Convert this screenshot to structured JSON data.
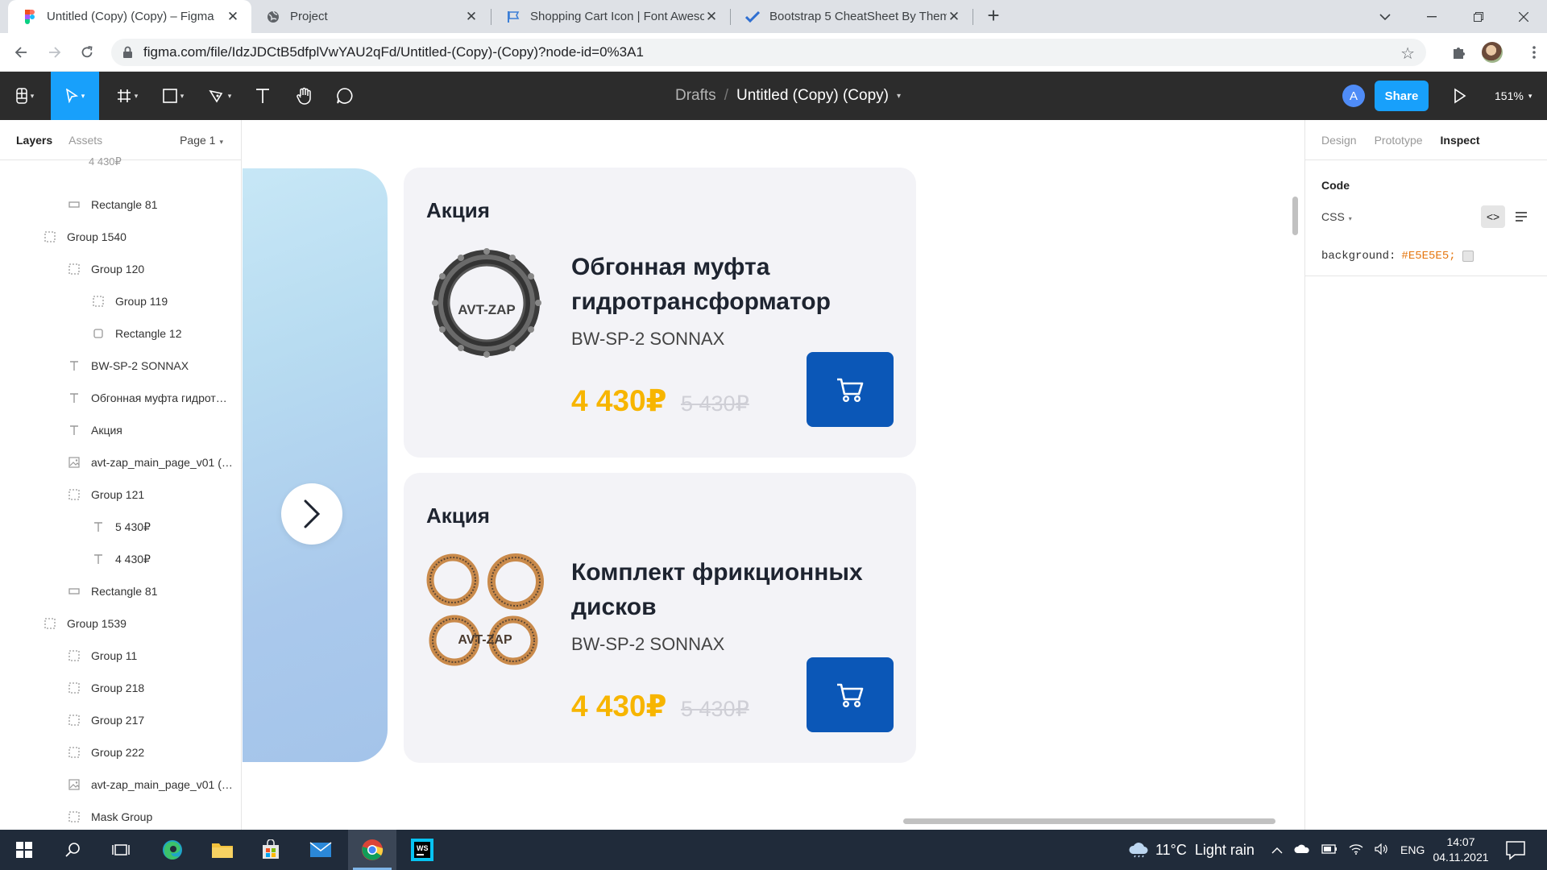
{
  "browser": {
    "tabs": [
      {
        "title": "Untitled (Copy) (Copy) – Figma",
        "icon": "figma-icon",
        "active": true
      },
      {
        "title": "Project",
        "icon": "globe-icon",
        "active": false
      },
      {
        "title": "Shopping Cart Icon | Font Aweso",
        "icon": "flag-icon",
        "active": false
      },
      {
        "title": "Bootstrap 5 CheatSheet By Them",
        "icon": "check-icon",
        "active": false
      }
    ],
    "url": "figma.com/file/IdzJDCtB5dfplVwYAU2qFd/Untitled-(Copy)-(Copy)?node-id=0%3A1"
  },
  "figma": {
    "toolbar": {
      "breadcrumb_root": "Drafts",
      "breadcrumb_separator": "/",
      "file_name": "Untitled (Copy) (Copy)",
      "user_initial": "A",
      "share_label": "Share",
      "zoom": "151%"
    },
    "left_panel": {
      "tab_layers": "Layers",
      "tab_assets": "Assets",
      "page": "Page 1",
      "cut_off_item": "4 430₽",
      "layers": [
        {
          "name": "Rectangle 81",
          "type": "rect",
          "indent": 2
        },
        {
          "name": "Group 1540",
          "type": "group",
          "indent": 1
        },
        {
          "name": "Group 120",
          "type": "group",
          "indent": 2
        },
        {
          "name": "Group 119",
          "type": "group",
          "indent": 3
        },
        {
          "name": "Rectangle 12",
          "type": "rect-round",
          "indent": 3
        },
        {
          "name": "BW-SP-2 SONNAX",
          "type": "text",
          "indent": 2
        },
        {
          "name": "Обгонная муфта гидрот…",
          "type": "text",
          "indent": 2
        },
        {
          "name": "Акция",
          "type": "text",
          "indent": 2
        },
        {
          "name": "avt-zap_main_page_v01 (…",
          "type": "image",
          "indent": 2
        },
        {
          "name": "Group 121",
          "type": "group",
          "indent": 2
        },
        {
          "name": "5 430₽",
          "type": "text",
          "indent": 3
        },
        {
          "name": "4 430₽",
          "type": "text",
          "indent": 3
        },
        {
          "name": "Rectangle 81",
          "type": "rect",
          "indent": 2
        },
        {
          "name": "Group 1539",
          "type": "group",
          "indent": 1
        },
        {
          "name": "Group 11",
          "type": "group",
          "indent": 2
        },
        {
          "name": "Group 218",
          "type": "group",
          "indent": 2
        },
        {
          "name": "Group 217",
          "type": "group",
          "indent": 2
        },
        {
          "name": "Group 222",
          "type": "group",
          "indent": 2
        },
        {
          "name": "avt-zap_main_page_v01 (…",
          "type": "image",
          "indent": 2
        },
        {
          "name": "Mask Group",
          "type": "group",
          "indent": 2
        }
      ]
    },
    "canvas": {
      "cards": [
        {
          "promo": "Акция",
          "name": "Обгонная муфта гидротрансформатор",
          "sku": "BW-SP-2 SONNAX",
          "price": "4 430₽",
          "old_price": "5 430₽",
          "image_icon": "one-way-clutch-image",
          "watermark": "AVT-ZAP"
        },
        {
          "promo": "Акция",
          "name": "Комплект фрикционных дисков",
          "sku": "BW-SP-2 SONNAX",
          "price": "4 430₽",
          "old_price": "5 430₽",
          "image_icon": "friction-discs-image",
          "watermark": "AVT-ZAP"
        }
      ],
      "colors": {
        "price": "#f7b500",
        "cart_button": "#0b57b7",
        "card_bg": "#f3f3f7"
      }
    },
    "right_panel": {
      "tabs": [
        "Design",
        "Prototype",
        "Inspect"
      ],
      "active_tab": "Inspect",
      "code_title": "Code",
      "language": "CSS",
      "css_property": "background:",
      "css_value": "#E5E5E5;"
    }
  },
  "taskbar": {
    "temperature": "11°C",
    "weather": "Light rain",
    "language": "ENG",
    "time": "14:07",
    "date": "04.11.2021"
  }
}
